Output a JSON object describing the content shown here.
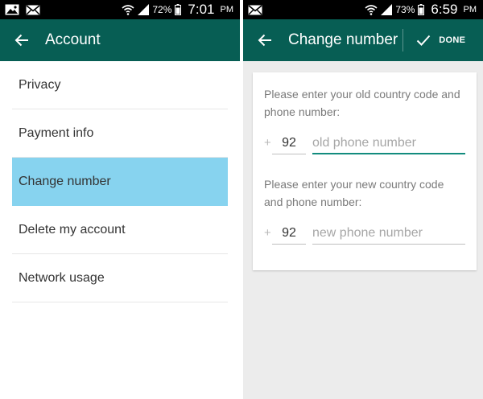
{
  "colors": {
    "appbar": "#075e54",
    "statusbar": "#000000",
    "highlight": "#87d3ef",
    "accent": "#128c7e"
  },
  "left": {
    "status": {
      "icons": [
        "image-icon",
        "mail-icon",
        "wifi-icon",
        "signal-icon",
        "battery-icon"
      ],
      "battery": "72%",
      "time": "7:01",
      "ampm": "PM"
    },
    "appbar": {
      "back_icon": "arrow-back-icon",
      "title": "Account"
    },
    "menu": [
      {
        "label": "Privacy"
      },
      {
        "label": "Payment info"
      },
      {
        "label": "Change number",
        "selected": true
      },
      {
        "label": "Delete my account"
      },
      {
        "label": "Network usage"
      }
    ]
  },
  "right": {
    "status": {
      "icons": [
        "mail-icon",
        "wifi-icon",
        "signal-icon",
        "battery-icon"
      ],
      "battery": "73%",
      "time": "6:59",
      "ampm": "PM"
    },
    "appbar": {
      "back_icon": "arrow-back-icon",
      "title": "Change number",
      "done_icon": "check-icon",
      "done_label": "DONE"
    },
    "form": {
      "old": {
        "prompt": "Please enter your old country code and phone number:",
        "plus": "+",
        "country_code": "92",
        "placeholder": "old phone number"
      },
      "new": {
        "prompt": "Please enter your new country code and phone number:",
        "plus": "+",
        "country_code": "92",
        "placeholder": "new phone number"
      }
    }
  }
}
